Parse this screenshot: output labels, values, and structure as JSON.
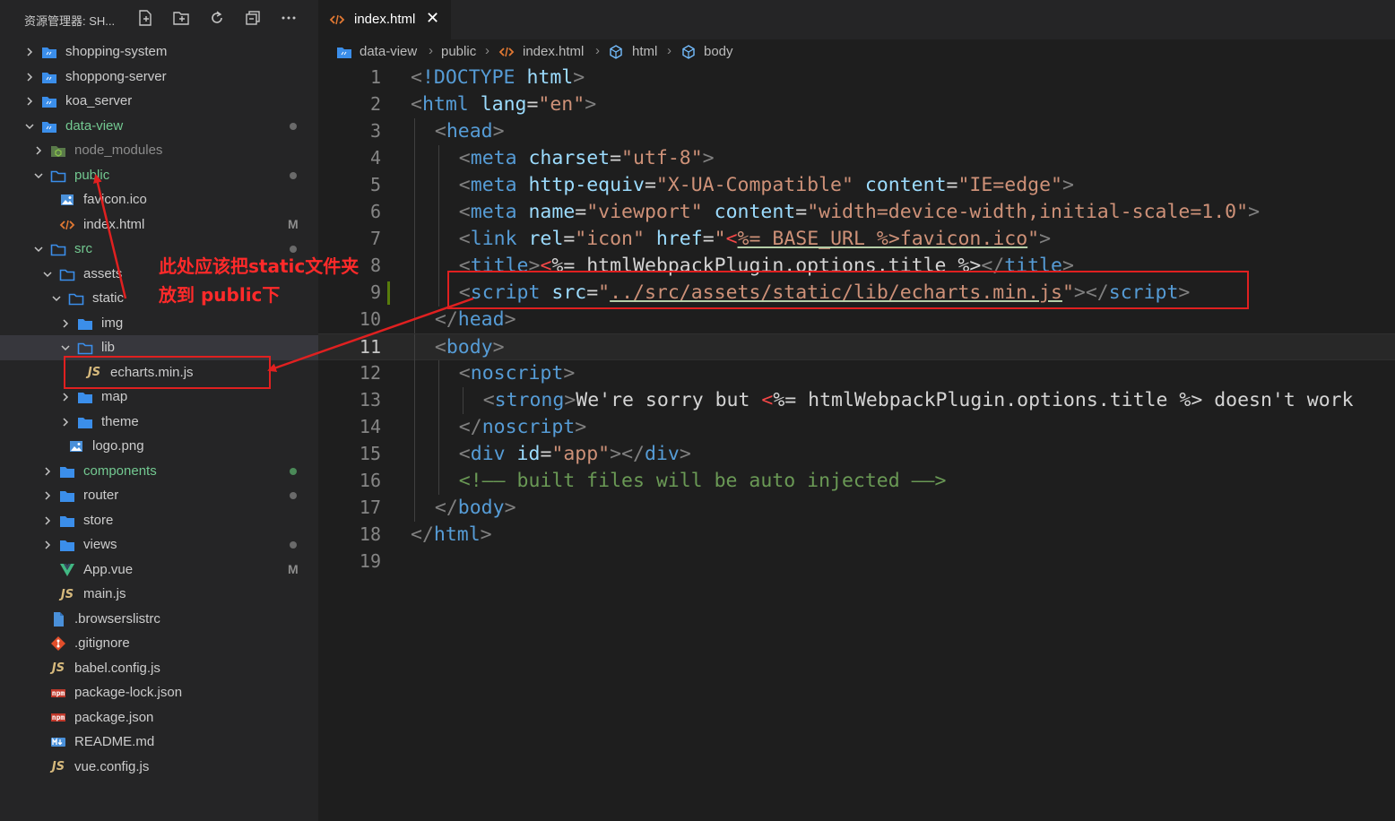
{
  "sidebar": {
    "title": "资源管理器: SH...",
    "actions": [
      "new-file-icon",
      "new-folder-icon",
      "refresh-icon",
      "collapse-all-icon",
      "more-icon"
    ]
  },
  "tree": [
    {
      "label": "shopping-system",
      "kind": "folder-project",
      "depth": 0,
      "expanded": false
    },
    {
      "label": "shoppong-server",
      "kind": "folder-project",
      "depth": 0,
      "expanded": false
    },
    {
      "label": "koa_server",
      "kind": "folder-project",
      "depth": 0,
      "expanded": false
    },
    {
      "label": "data-view",
      "kind": "folder-project",
      "depth": 0,
      "expanded": true,
      "status": "dot",
      "color": "git"
    },
    {
      "label": "node_modules",
      "kind": "folder-node",
      "depth": 1,
      "expanded": false,
      "color": "ignored"
    },
    {
      "label": "public",
      "kind": "folder",
      "depth": 1,
      "expanded": true,
      "status": "dot",
      "color": "git"
    },
    {
      "label": "favicon.ico",
      "kind": "image",
      "depth": 2
    },
    {
      "label": "index.html",
      "kind": "html",
      "depth": 2,
      "status": "M"
    },
    {
      "label": "src",
      "kind": "folder",
      "depth": 1,
      "expanded": true,
      "status": "dot",
      "color": "git"
    },
    {
      "label": "assets",
      "kind": "folder",
      "depth": 2,
      "expanded": true
    },
    {
      "label": "static",
      "kind": "folder",
      "depth": 3,
      "expanded": true
    },
    {
      "label": "img",
      "kind": "folder-filled",
      "depth": 4,
      "expanded": false
    },
    {
      "label": "lib",
      "kind": "folder",
      "depth": 4,
      "expanded": true,
      "selected": true
    },
    {
      "label": "echarts.min.js",
      "kind": "js",
      "depth": 5
    },
    {
      "label": "map",
      "kind": "folder-filled",
      "depth": 4,
      "expanded": false
    },
    {
      "label": "theme",
      "kind": "folder-filled",
      "depth": 4,
      "expanded": false
    },
    {
      "label": "logo.png",
      "kind": "image",
      "depth": 3
    },
    {
      "label": "components",
      "kind": "folder-filled",
      "depth": 2,
      "expanded": false,
      "status": "dot-green",
      "color": "green"
    },
    {
      "label": "router",
      "kind": "folder-filled",
      "depth": 2,
      "expanded": false,
      "status": "dot"
    },
    {
      "label": "store",
      "kind": "folder-filled",
      "depth": 2,
      "expanded": false
    },
    {
      "label": "views",
      "kind": "folder-filled",
      "depth": 2,
      "expanded": false,
      "status": "dot"
    },
    {
      "label": "App.vue",
      "kind": "vue",
      "depth": 2,
      "status": "M"
    },
    {
      "label": "main.js",
      "kind": "js",
      "depth": 2
    },
    {
      "label": ".browserslistrc",
      "kind": "file",
      "depth": 1
    },
    {
      "label": ".gitignore",
      "kind": "git",
      "depth": 1
    },
    {
      "label": "babel.config.js",
      "kind": "js",
      "depth": 1
    },
    {
      "label": "package-lock.json",
      "kind": "npm",
      "depth": 1
    },
    {
      "label": "package.json",
      "kind": "npm",
      "depth": 1
    },
    {
      "label": "README.md",
      "kind": "md",
      "depth": 1
    },
    {
      "label": "vue.config.js",
      "kind": "js",
      "depth": 1
    }
  ],
  "tabs": [
    {
      "label": "index.html",
      "close": "✕",
      "active": true
    }
  ],
  "breadcrumb": [
    "data-view",
    "public",
    "index.html",
    "html",
    "body"
  ],
  "editor": {
    "current_line": 11,
    "lines": [
      {
        "n": "1",
        "indent": 0,
        "tokens": [
          [
            "b",
            "<"
          ],
          [
            "d",
            "!DOCTYPE"
          ],
          [
            "t",
            " "
          ],
          [
            "a",
            "html"
          ],
          [
            "b",
            ">"
          ]
        ]
      },
      {
        "n": "2",
        "indent": 0,
        "tokens": [
          [
            "b",
            "<"
          ],
          [
            "k",
            "html"
          ],
          [
            "t",
            " "
          ],
          [
            "a",
            "lang"
          ],
          [
            "e",
            "="
          ],
          [
            "s",
            "\"en\""
          ],
          [
            "b",
            ">"
          ]
        ]
      },
      {
        "n": "3",
        "indent": 1,
        "tokens": [
          [
            "b",
            "<"
          ],
          [
            "k",
            "head"
          ],
          [
            "b",
            ">"
          ]
        ]
      },
      {
        "n": "4",
        "indent": 2,
        "tokens": [
          [
            "b",
            "<"
          ],
          [
            "k",
            "meta"
          ],
          [
            "t",
            " "
          ],
          [
            "a",
            "charset"
          ],
          [
            "e",
            "="
          ],
          [
            "s",
            "\"utf-8\""
          ],
          [
            "b",
            ">"
          ]
        ]
      },
      {
        "n": "5",
        "indent": 2,
        "tokens": [
          [
            "b",
            "<"
          ],
          [
            "k",
            "meta"
          ],
          [
            "t",
            " "
          ],
          [
            "a",
            "http-equiv"
          ],
          [
            "e",
            "="
          ],
          [
            "s",
            "\"X-UA-Compatible\""
          ],
          [
            "t",
            " "
          ],
          [
            "a",
            "content"
          ],
          [
            "e",
            "="
          ],
          [
            "s",
            "\"IE=edge\""
          ],
          [
            "b",
            ">"
          ]
        ]
      },
      {
        "n": "6",
        "indent": 2,
        "tokens": [
          [
            "b",
            "<"
          ],
          [
            "k",
            "meta"
          ],
          [
            "t",
            " "
          ],
          [
            "a",
            "name"
          ],
          [
            "e",
            "="
          ],
          [
            "s",
            "\"viewport\""
          ],
          [
            "t",
            " "
          ],
          [
            "a",
            "content"
          ],
          [
            "e",
            "="
          ],
          [
            "s",
            "\"width=device-width,initial-scale=1.0\""
          ],
          [
            "b",
            ">"
          ]
        ]
      },
      {
        "n": "7",
        "indent": 2,
        "tokens": [
          [
            "b",
            "<"
          ],
          [
            "k",
            "link"
          ],
          [
            "t",
            " "
          ],
          [
            "a",
            "rel"
          ],
          [
            "e",
            "="
          ],
          [
            "s",
            "\"icon\""
          ],
          [
            "t",
            " "
          ],
          [
            "a",
            "href"
          ],
          [
            "e",
            "="
          ],
          [
            "s",
            "\""
          ],
          [
            "r",
            "<"
          ],
          [
            "su",
            "%= BASE_URL %>favicon.ico"
          ],
          [
            "s",
            "\""
          ],
          [
            "b",
            ">"
          ]
        ]
      },
      {
        "n": "8",
        "indent": 2,
        "tokens": [
          [
            "b",
            "<"
          ],
          [
            "k",
            "title"
          ],
          [
            "b",
            ">"
          ],
          [
            "r",
            "<"
          ],
          [
            "t",
            "%= htmlWebpackPlugin.options.title %>"
          ],
          [
            "b",
            "</"
          ],
          [
            "k",
            "title"
          ],
          [
            "b",
            ">"
          ]
        ]
      },
      {
        "n": "9",
        "indent": 2,
        "tokens": [
          [
            "b",
            "<"
          ],
          [
            "k",
            "script"
          ],
          [
            "t",
            " "
          ],
          [
            "a",
            "src"
          ],
          [
            "e",
            "="
          ],
          [
            "s",
            "\""
          ],
          [
            "su",
            "../src/assets/static/lib/echarts.min.js"
          ],
          [
            "s",
            "\""
          ],
          [
            "b",
            "></"
          ],
          [
            "k",
            "script"
          ],
          [
            "b",
            ">"
          ]
        ]
      },
      {
        "n": "10",
        "indent": 1,
        "tokens": [
          [
            "b",
            "</"
          ],
          [
            "k",
            "head"
          ],
          [
            "b",
            ">"
          ]
        ]
      },
      {
        "n": "11",
        "indent": 1,
        "tokens": [
          [
            "b",
            "<"
          ],
          [
            "k",
            "body"
          ],
          [
            "b",
            ">"
          ]
        ]
      },
      {
        "n": "12",
        "indent": 2,
        "tokens": [
          [
            "b",
            "<"
          ],
          [
            "k",
            "noscript"
          ],
          [
            "b",
            ">"
          ]
        ]
      },
      {
        "n": "13",
        "indent": 3,
        "tokens": [
          [
            "b",
            "<"
          ],
          [
            "k",
            "strong"
          ],
          [
            "b",
            ">"
          ],
          [
            "t",
            "We're sorry but "
          ],
          [
            "r",
            "<"
          ],
          [
            "t",
            "%= htmlWebpackPlugin.options.title %> doesn't work"
          ]
        ]
      },
      {
        "n": "14",
        "indent": 2,
        "tokens": [
          [
            "b",
            "</"
          ],
          [
            "k",
            "noscript"
          ],
          [
            "b",
            ">"
          ]
        ]
      },
      {
        "n": "15",
        "indent": 2,
        "tokens": [
          [
            "b",
            "<"
          ],
          [
            "k",
            "div"
          ],
          [
            "t",
            " "
          ],
          [
            "a",
            "id"
          ],
          [
            "e",
            "="
          ],
          [
            "s",
            "\"app\""
          ],
          [
            "b",
            "></"
          ],
          [
            "k",
            "div"
          ],
          [
            "b",
            ">"
          ]
        ]
      },
      {
        "n": "16",
        "indent": 2,
        "tokens": [
          [
            "c",
            "<!—— built files will be auto injected ——>"
          ]
        ]
      },
      {
        "n": "17",
        "indent": 1,
        "tokens": [
          [
            "b",
            "</"
          ],
          [
            "k",
            "body"
          ],
          [
            "b",
            ">"
          ]
        ]
      },
      {
        "n": "18",
        "indent": 0,
        "tokens": [
          [
            "b",
            "</"
          ],
          [
            "k",
            "html"
          ],
          [
            "b",
            ">"
          ]
        ]
      },
      {
        "n": "19",
        "indent": 0,
        "tokens": []
      }
    ]
  },
  "annotation": {
    "text_line1": "此处应该把static文件夹",
    "text_line2": "放到 public下",
    "color": "#e02020"
  },
  "colors": {
    "tag": "#569cd6",
    "attribute": "#9cdcfe",
    "string": "#ce9178",
    "bracket": "#808080",
    "folder": "#3b8eea",
    "accent_red": "#e02020"
  }
}
